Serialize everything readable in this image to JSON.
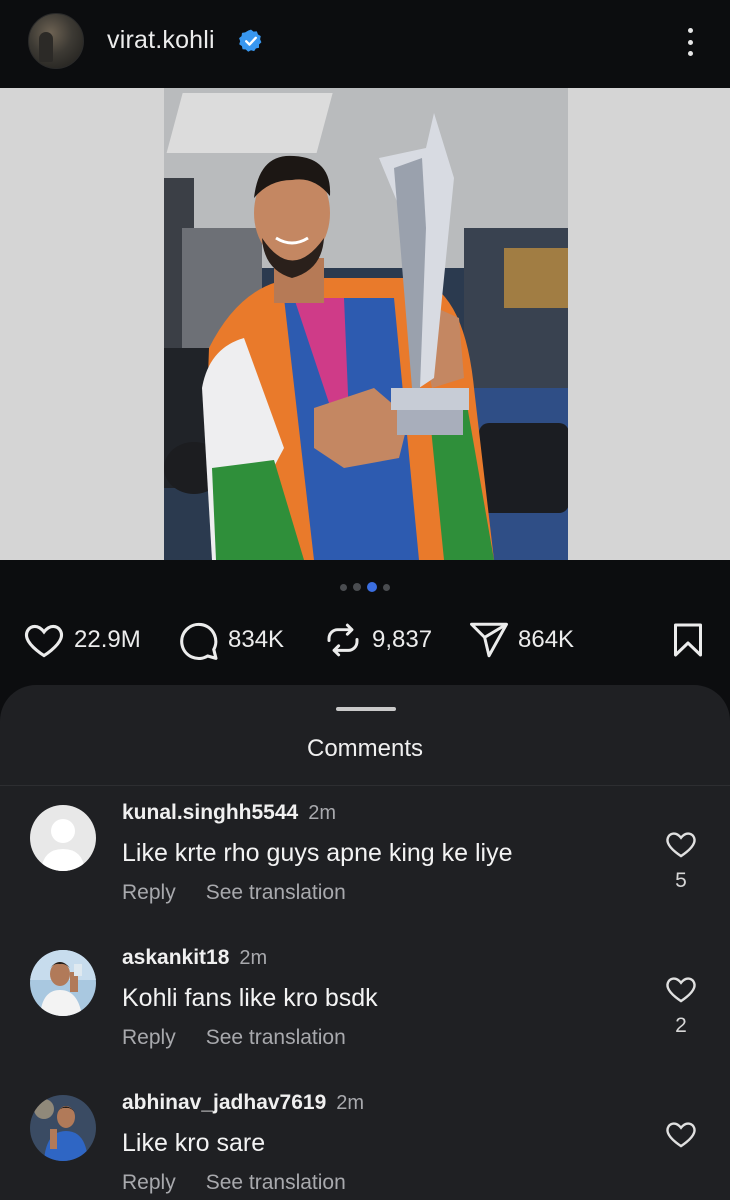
{
  "header": {
    "username": "virat.kohli",
    "verified_icon": "verified-badge-icon",
    "more_icon": "more-vertical-icon"
  },
  "post": {
    "carousel": {
      "total": 4,
      "active_index": 2
    },
    "actions": {
      "likes": "22.9M",
      "comments": "834K",
      "reposts": "9,837",
      "shares": "864K"
    }
  },
  "comments_sheet": {
    "title": "Comments",
    "reply_label": "Reply",
    "translate_label": "See translation",
    "items": [
      {
        "user": "kunal.singhh5544",
        "time": "2m",
        "text": "Like krte rho guys apne king ke liye",
        "likes": "5"
      },
      {
        "user": "askankit18",
        "time": "2m",
        "text": "Kohli fans like kro bsdk",
        "likes": "2"
      },
      {
        "user": "abhinav_jadhav7619",
        "time": "2m",
        "text": "Like kro sare",
        "likes": ""
      }
    ]
  },
  "colors": {
    "background": "#0c0d0f",
    "sheet": "#1f2023",
    "verified": "#3897f0",
    "active_dot": "#3b6ee0"
  }
}
